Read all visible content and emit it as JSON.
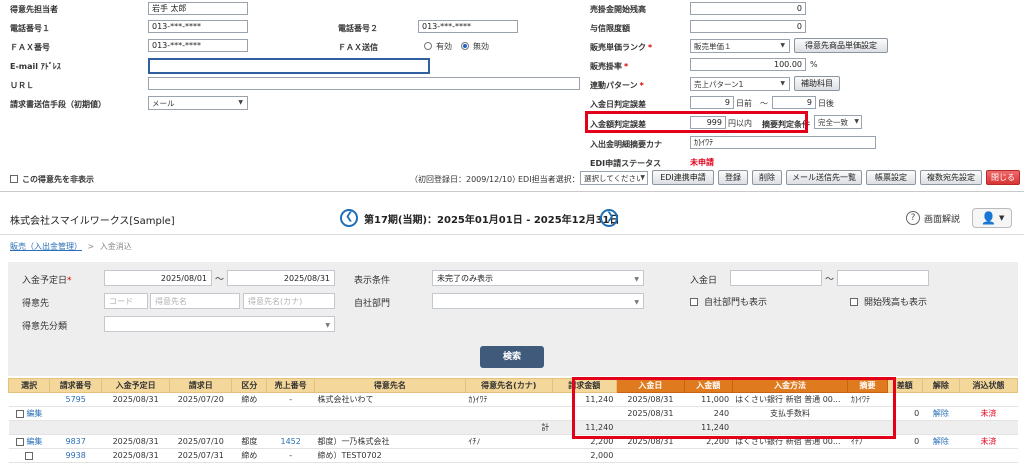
{
  "top_form": {
    "rows": [
      {
        "label": "得意先担当者",
        "value": "岩手 太郎"
      },
      {
        "label": "電話番号１",
        "value": "013-***-****"
      },
      {
        "label": "ＦＡＸ番号",
        "value": "013-***-****"
      },
      {
        "label": "E-mail ｱﾄﾞﾚｽ",
        "value": ""
      },
      {
        "label": "ＵＲＬ",
        "value": ""
      },
      {
        "label": "請求書送信手段（初期値）",
        "value": "メール"
      }
    ],
    "tel2_label": "電話番号２",
    "tel2_value": "013-***-****",
    "fax_send_label": "ＦＡＸ送信",
    "fax_send_options": [
      "有効",
      "無効"
    ],
    "fax_send_selected": "無効",
    "right_rows": [
      {
        "label": "売掛金開始残高",
        "value": "0"
      },
      {
        "label": "与信限度額",
        "value": "0"
      },
      {
        "label": "販売単価ランク",
        "value": "販売単価１"
      },
      {
        "label": "販売掛率",
        "value": "100.00"
      },
      {
        "label": "連動パターン",
        "value": "売上パターン1"
      },
      {
        "label": "入金日判定誤差",
        "value": "9"
      },
      {
        "label": "入金額判定誤差",
        "value": "999"
      },
      {
        "label": "入出金明細摘要カナ",
        "value": "ｶ)ｲﾜﾃ"
      },
      {
        "label": "EDI申請ステータス",
        "value": "未申請"
      }
    ],
    "unit_percent": "%",
    "btn_price_settings": "得意先商品単価設定",
    "btn_auxiliary": "補助科目",
    "day_before": "日前",
    "range_sep": "～",
    "day_after_value": "9",
    "day_after": "日後",
    "yen_within": "円以内",
    "summary_condition_label": "摘要判定条件",
    "summary_condition_value": "完全一致",
    "hide_label": "この得意先を非表示",
    "initial_reg": "（初回登録日：2009/12/10）",
    "edi_person_label": "EDI担当者選択：",
    "edi_person_value": "選択してください",
    "buttons": [
      "EDI連携申請",
      "登録",
      "削除",
      "メール送信先一覧",
      "帳票設定",
      "複数宛先設定",
      "閉じる"
    ]
  },
  "header": {
    "company": "株式会社スマイルワークス[Sample]",
    "period": "第17期(当期)：2025年01月01日 - 2025年12月31日",
    "help": "画面解説"
  },
  "breadcrumb": {
    "parent": "販売（入出金管理）",
    "sep": ">",
    "current": "入金消込"
  },
  "filter": {
    "scheduled_date_label": "入金予定日",
    "scheduled_from": "2025/08/01",
    "scheduled_to": "2025/08/31",
    "range_sep": "～",
    "display_cond_label": "表示条件",
    "display_cond_value": "未完了のみ表示",
    "payment_date_label": "入金日",
    "customer_label": "得意先",
    "ph_code": "コード",
    "ph_name": "得意先名",
    "ph_kana": "得意先名(カナ)",
    "own_dept_label": "自社部門",
    "show_own_dept": "自社部門も表示",
    "show_opening": "開始残高も表示",
    "customer_class_label": "得意先分類",
    "search_button": "検索"
  },
  "table": {
    "headers": [
      "選択",
      "請求番号",
      "入金予定日",
      "請求日",
      "区分",
      "売上番号",
      "得意先名",
      "得意先名(カナ)",
      "請求金額",
      "入金日",
      "入金額",
      "入金方法",
      "摘要",
      "差額",
      "解除",
      "消込状態"
    ],
    "edit_label": "編集",
    "release_label": "解除",
    "status_unsettled": "未済",
    "rows": [
      {
        "no": "5795",
        "scheduled": "2025/08/31",
        "invoice_date": "2025/07/20",
        "kubun": "締め",
        "sales_no": "-",
        "customer": "株式会社いわて",
        "kana": "ｶ)ｲﾜﾃ",
        "amount": "11,240",
        "details": [
          {
            "date": "2025/08/31",
            "amount": "11,000",
            "method": "はくさい銀行 新宿 普通 00...",
            "memo": "ｶ)ｲﾜﾃ"
          },
          {
            "date": "2025/08/31",
            "amount": "240",
            "method": "支払手数料",
            "memo": ""
          }
        ],
        "sum_label": "計",
        "sum_amount": "11,240",
        "sum_paid": "11,240",
        "diff": "0"
      },
      {
        "no": "9837",
        "scheduled": "2025/08/31",
        "invoice_date": "2025/07/10",
        "kubun": "都度",
        "sales_no": "1452",
        "customer": "都度）一乃株式会社",
        "kana": "ｲﾁﾉ",
        "amount": "2,200",
        "pay_date": "2025/08/31",
        "pay_amount": "2,200",
        "method": "はくさい銀行 新宿 普通 00...",
        "memo": "ｲﾁﾉ",
        "diff": "0"
      },
      {
        "no": "9938",
        "scheduled": "2025/08/31",
        "invoice_date": "2025/07/31",
        "kubun": "締め",
        "sales_no": "-",
        "customer": "締め）TEST0702",
        "kana": "",
        "amount": "2,000"
      }
    ]
  }
}
